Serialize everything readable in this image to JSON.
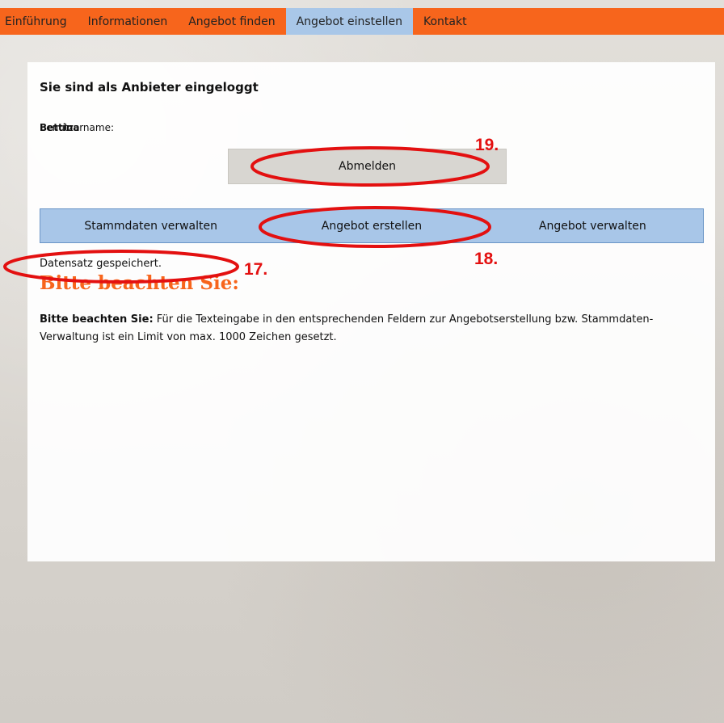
{
  "nav": {
    "items": [
      {
        "label": "Einführung"
      },
      {
        "label": "Informationen"
      },
      {
        "label": "Angebot finden"
      },
      {
        "label": "Angebot einstellen",
        "active": true
      },
      {
        "label": "Kontakt"
      }
    ]
  },
  "content": {
    "headline": "Sie sind als Anbieter eingeloggt",
    "user_label": "Benutzername:",
    "user_overlap": "Bettina",
    "logout_label": "Abmelden",
    "subnav": [
      {
        "label": "Stammdaten verwalten"
      },
      {
        "label": "Angebot erstellen"
      },
      {
        "label": "Angebot verwalten"
      }
    ],
    "status": "Datensatz gespeichert.",
    "notice_title": "Bitte beachten Sie:",
    "notice_lead": "Bitte beachten Sie:",
    "notice_body": " Für die Texteingabe in den entsprechenden Feldern zur Angebotserstellung bzw. Stammdaten-Verwaltung ist ein Limit von max. 1000 Zeichen gesetzt."
  },
  "annotations": {
    "labels": [
      "17.",
      "18.",
      "19."
    ],
    "color": "#e31010"
  },
  "colors": {
    "nav_bg": "#f7651c",
    "nav_active": "#a9c7e8",
    "subnav_bg": "#a8c6e8",
    "title_orange": "#f7651c"
  }
}
